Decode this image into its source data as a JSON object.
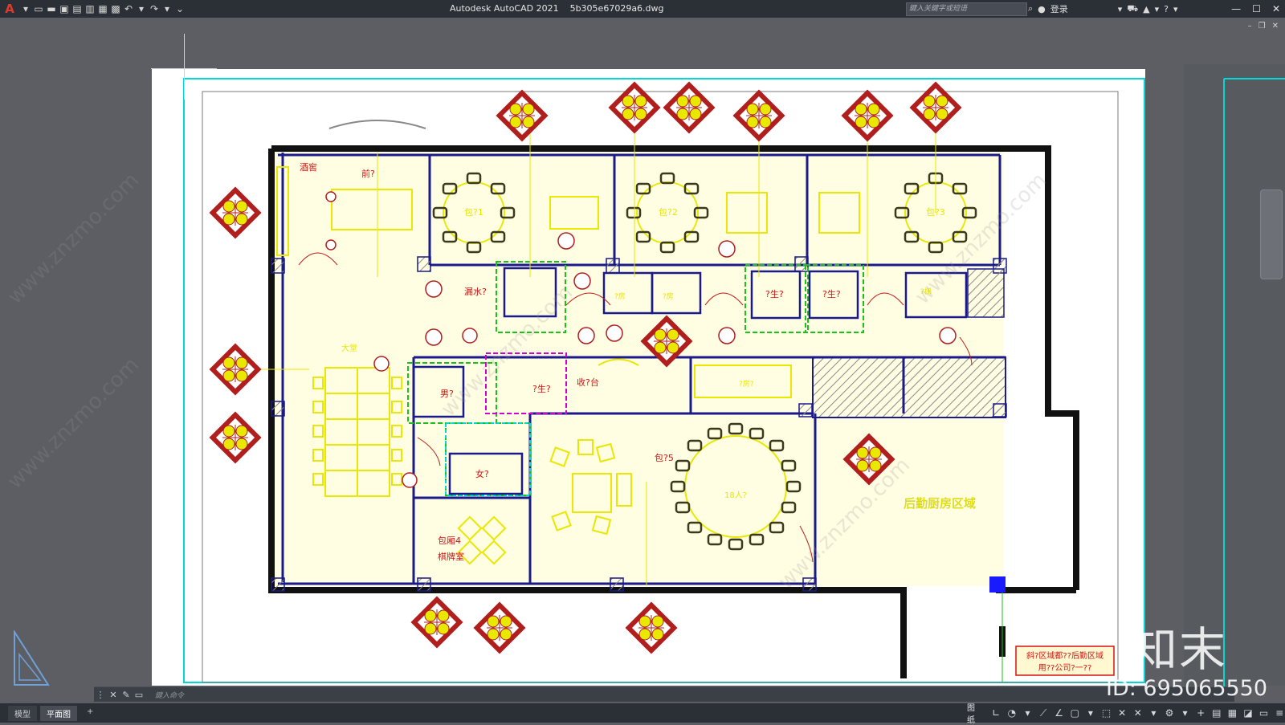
{
  "titlebar": {
    "app_icon": "A",
    "title": "Autodesk AutoCAD 2021    5b305e67029a6.dwg",
    "search_placeholder": "鍵入关鍵字或短语",
    "sign_in": "登录",
    "icons": [
      "new-icon",
      "open-icon",
      "save-icon",
      "saveas-icon",
      "plot-preview-icon",
      "publish-icon",
      "print-icon",
      "undo-icon",
      "redo-icon",
      "customize-icon"
    ]
  },
  "drawing": {
    "room_labels": {
      "wine_cellar": "酒窖",
      "reception": "前?",
      "lobby": "大堂",
      "private1": "包?1",
      "private2": "包?2",
      "private3": "包?3",
      "water_bar": "漏水?",
      "men": "男?",
      "women": "女?",
      "restroom": "?生?",
      "restroom_a": "?生?",
      "restroom_b": "?生?",
      "cashier": "收?台",
      "private5": "包?5",
      "seats": "18人?",
      "private4": "包厢4",
      "private4_sub": "棋牌室",
      "back_kitchen": "后勤厨房区域",
      "small_a": "?房",
      "small_b": "?房",
      "corridor": "?房?",
      "stair": "?梯"
    },
    "note_line1": "斜?区域都??后勤区域",
    "note_line2": "用??公司?一??",
    "watermark_text": "www.znzmo.com"
  },
  "command_line": {
    "placeholder": "鍵入命令"
  },
  "statusbar": {
    "tabs": [
      "模型",
      "平面图"
    ],
    "add_tab": "+",
    "paper_label": "图纸"
  },
  "watermark": {
    "logo": "知末",
    "id": "ID: 695065550"
  },
  "colors": {
    "wall": "#1a1a8c",
    "furniture": "#e8e800",
    "label_red": "#d41414",
    "light_fixture_red": "#b01e1e",
    "cyan_frame": "#00e5e5",
    "green_dashed": "#19c219",
    "hatch": "#7a7a7a",
    "background": "#5c5e63"
  }
}
